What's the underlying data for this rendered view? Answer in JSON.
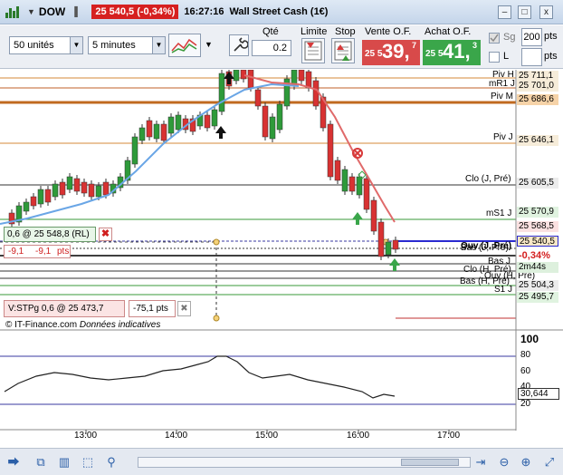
{
  "titlebar": {
    "symbol": "DOW",
    "price_change": "25 540,5 (-0,34%)",
    "time": "16:27:16",
    "title": "Wall Street Cash (1€)",
    "minimize": "–",
    "maximize": "□",
    "close": "x"
  },
  "toolbar": {
    "units_value": "50 unités",
    "timeframe_value": "5 minutes",
    "qty_label": "Qté",
    "qty_value": "0.2",
    "limit_label": "Limite",
    "stop_label": "Stop",
    "sell_label": "Vente O.F.",
    "sell_small": "25 5",
    "sell_big": "39,",
    "sell_sup": "7",
    "buy_label": "Achat O.F.",
    "buy_small": "25 5",
    "buy_big": "41,",
    "buy_sup": "3",
    "sg_label": "Sg",
    "l_label": "L",
    "pts_value_1": "200",
    "pts_label_1": "pts",
    "pts_label_2": "pts",
    "colors": {
      "sell": "#d84a4a",
      "buy": "#3aa64a"
    }
  },
  "chart": {
    "price_tags": [
      {
        "label": "25 711,1",
        "bg": "#f6ecd9",
        "color": "#000"
      },
      {
        "label": "25 701,0",
        "bg": "#f6ecd9",
        "color": "#000"
      },
      {
        "label": "25 686,6",
        "bg": "#f6d3a8",
        "color": "#000"
      },
      {
        "label": "25 646,1",
        "bg": "#f6ecd9",
        "color": "#000"
      },
      {
        "label": "25 605,5",
        "bg": "#ececec",
        "color": "#000"
      },
      {
        "label": "25 570,9",
        "bg": "#e0f3e0",
        "color": "#000"
      },
      {
        "label": "25 568,5",
        "bg": "#fbe1e1",
        "color": "#000"
      },
      {
        "label": "25 540,5",
        "bg": "#f8e8c8",
        "color": "#000"
      },
      {
        "label": "-0,34%",
        "bg": "#fff",
        "color": "#d42020"
      },
      {
        "label": "2m44s",
        "bg": "#ddf0dd",
        "color": "#000"
      },
      {
        "label": "25 504,3",
        "bg": "#ececec",
        "color": "#000"
      },
      {
        "label": "25 495,7",
        "bg": "#e0f3e0",
        "color": "#000"
      }
    ],
    "line_labels": {
      "piv_h": "Piv H",
      "mr1_j": "mR1 J",
      "piv_m": "Piv M",
      "piv_j": "Piv J",
      "clo_j_pre": "Clo (J, Pré)",
      "ms1_j": "mS1 J",
      "ouv_j_pre": "Ouv (J, Pré)",
      "bas_j_pre": "Bas (J, Pré)",
      "bas_j": "Bas J",
      "clo_h_pre": "Clo (H, Pré)",
      "ouv_h_pre": "Ouv (H, Pré)",
      "bas_h_pre": "Bas (H, Pré)",
      "s1_j": "S1 J"
    },
    "position": {
      "label": "0,6 @ 25 548,8 (RL)",
      "pnl_1": "-9,1",
      "pnl_2": "-9,1",
      "pnl_unit": "pts"
    },
    "stop_order": {
      "label": "V:STPg  0,6 @ 25 473,7",
      "value": "-75,1 pts"
    },
    "credit_1": "© IT-Finance.com",
    "credit_2": "Données indicatives",
    "indicator": {
      "ticks": [
        "100",
        "80",
        "60",
        "40",
        "20"
      ],
      "value": "30,644"
    },
    "time_labels": [
      "13:00",
      "14:00",
      "15:00",
      "16:00",
      "17:00"
    ]
  }
}
